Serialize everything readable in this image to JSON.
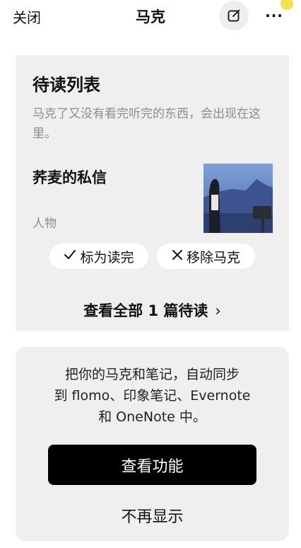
{
  "header": {
    "close_label": "关闭",
    "title": "马克",
    "edit_icon": "edit-square-icon",
    "more_label": "···"
  },
  "reading_list": {
    "title": "待读列表",
    "description": "马克了又没有看完听完的东西，会出现在这里。",
    "item": {
      "title": "荞麦的私信",
      "tag": "人物"
    },
    "mark_done_label": "标为读完",
    "remove_label": "移除马克",
    "view_all_label": "查看全部 1 篇待读",
    "chevron": "›"
  },
  "sync_promo": {
    "text_line1": "把你的马克和笔记，自动同步",
    "text_line2": "到 flomo、印象笔记、Evernote",
    "text_line3": "和 OneNote 中。",
    "primary_label": "查看功能",
    "dismiss_label": "不再显示"
  },
  "colors": {
    "card_bg": "#efefef",
    "notify_dot": "#f5e04a",
    "primary_btn": "#000000",
    "muted_text": "#8d8d8d"
  }
}
